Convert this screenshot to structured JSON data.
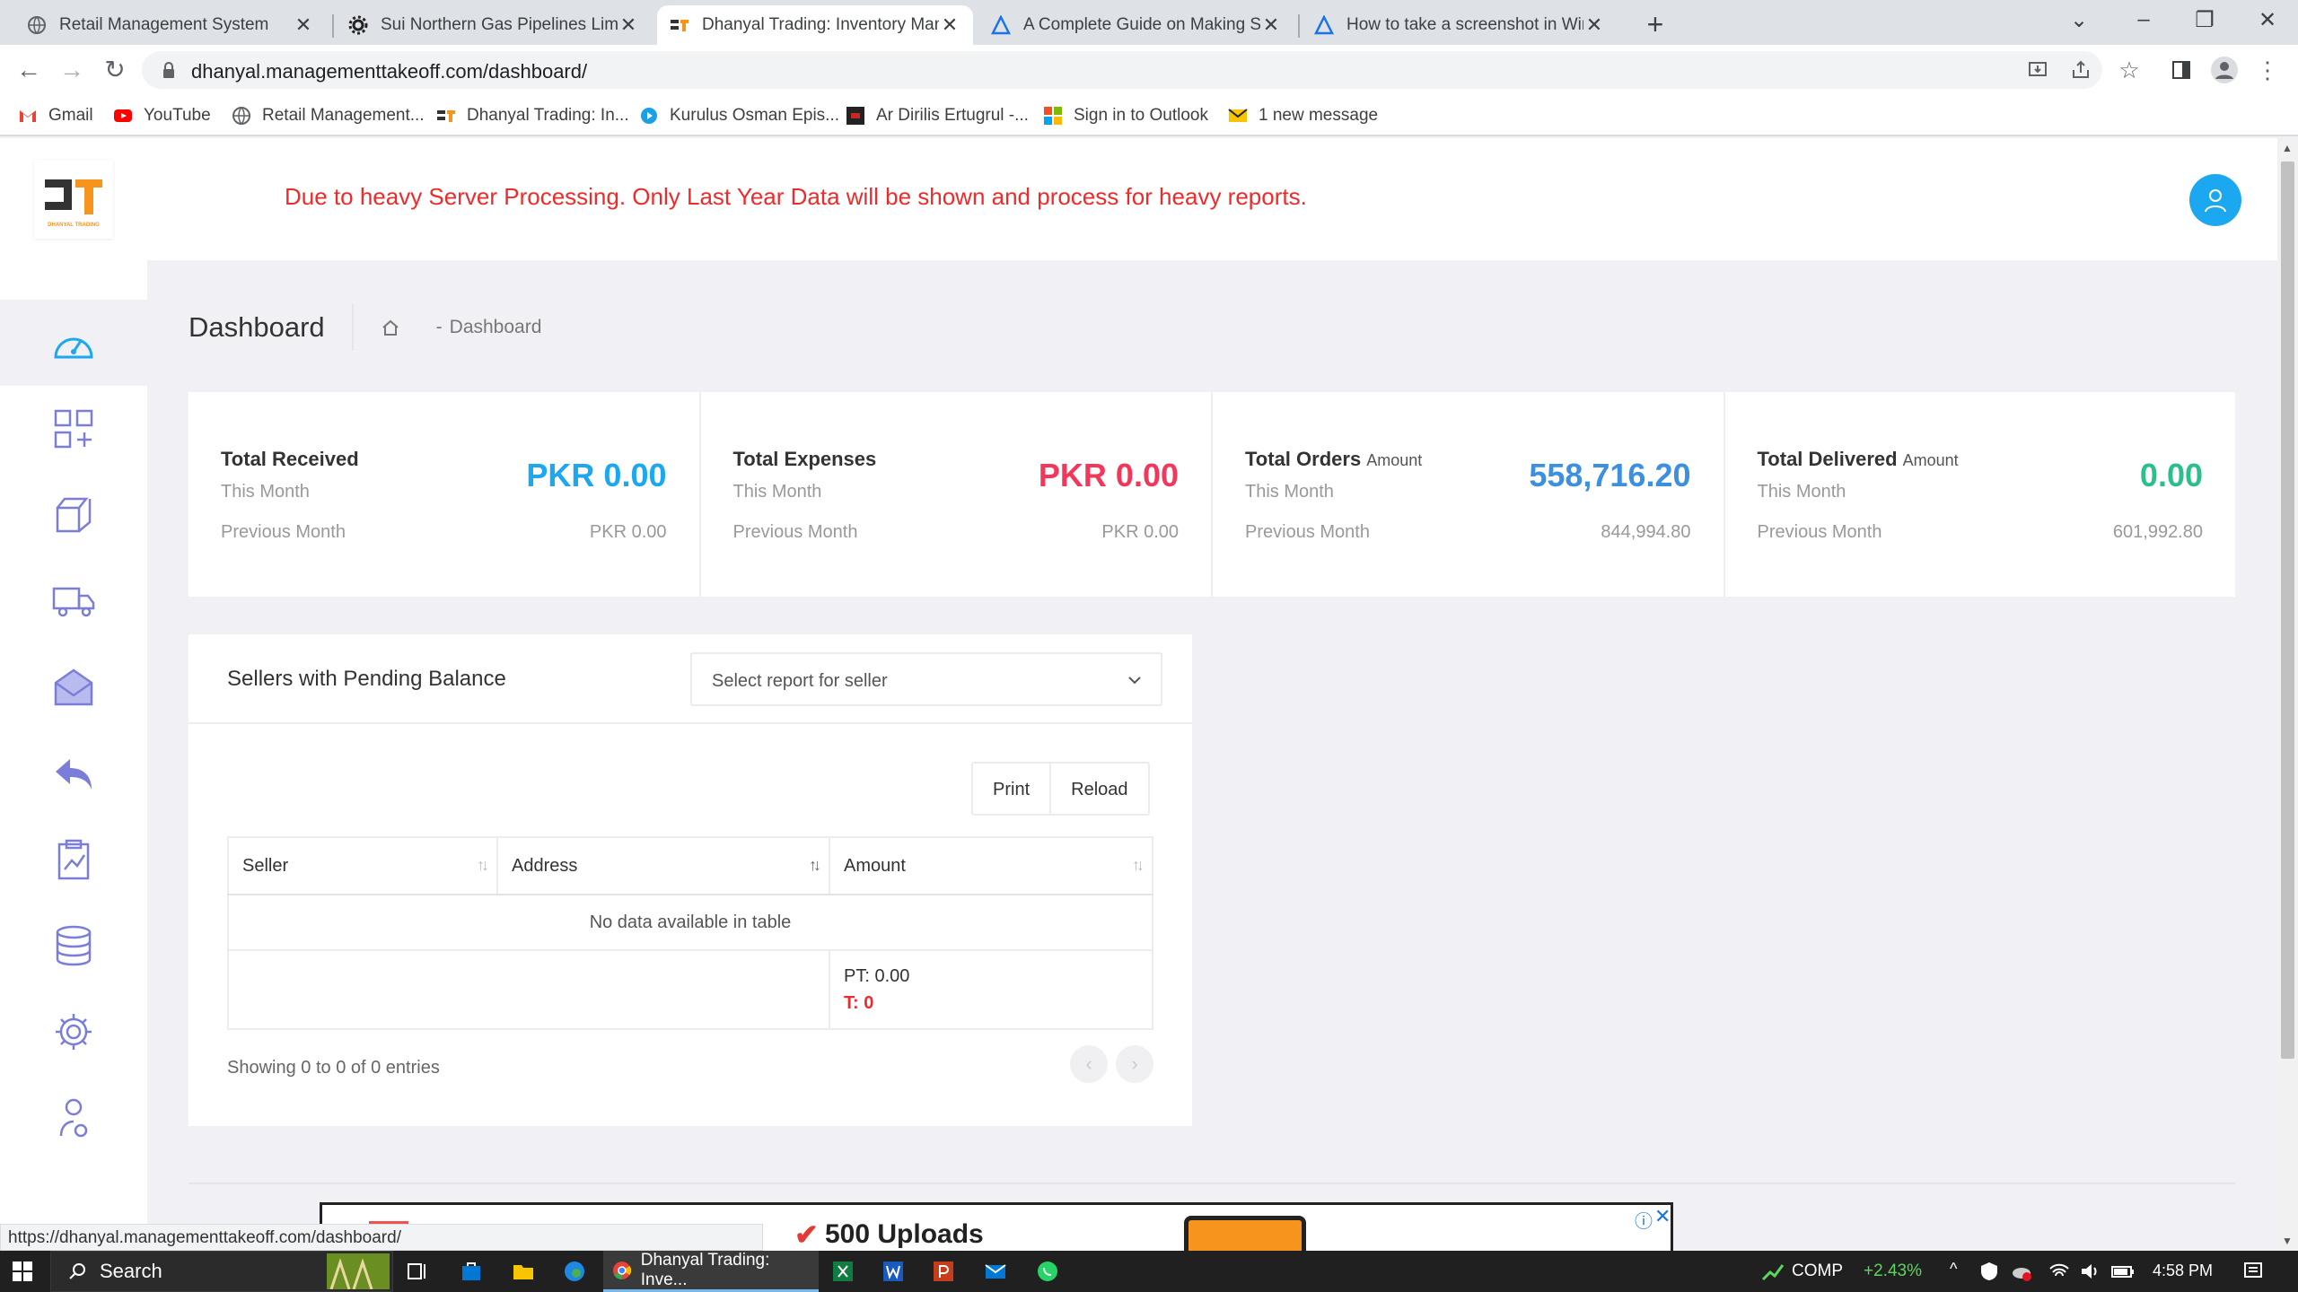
{
  "browser": {
    "tabs": [
      {
        "title": "Retail Management System"
      },
      {
        "title": "Sui Northern Gas Pipelines Limite"
      },
      {
        "title": "Dhanyal Trading: Inventory Mana"
      },
      {
        "title": "A Complete Guide on Making Sc"
      },
      {
        "title": "How to take a screenshot in Wind"
      }
    ],
    "url": "dhanyal.managementtakeoff.com/dashboard/",
    "bookmarks": [
      {
        "label": "Gmail"
      },
      {
        "label": "YouTube"
      },
      {
        "label": "Retail Management..."
      },
      {
        "label": "Dhanyal Trading: In..."
      },
      {
        "label": "Kurulus Osman Epis..."
      },
      {
        "label": "Ar Dirilis Ertugrul -..."
      },
      {
        "label": "Sign in to Outlook"
      },
      {
        "label": "1 new message"
      }
    ],
    "status_url": "https://dhanyal.managementtakeoff.com/dashboard/"
  },
  "app": {
    "logo_text": "DHANYAL TRADING",
    "notice": "Due to heavy Server Processing. Only Last Year Data will be shown and process for heavy reports.",
    "page_title": "Dashboard",
    "breadcrumb": "Dashboard",
    "sidebar_icons": [
      "dashboard-gauge-icon",
      "add-grid-icon",
      "packages-icon",
      "delivery-truck-icon",
      "mail-icon",
      "return-icon",
      "report-clipboard-icon",
      "coins-icon",
      "settings-gear-icon",
      "user-settings-icon"
    ]
  },
  "stats": [
    {
      "title": "Total Received",
      "suffix": "",
      "sub": "This Month",
      "value": "PKR 0.00",
      "prev_label": "Previous Month",
      "prev_value": "PKR 0.00",
      "color": "#1ba8f0"
    },
    {
      "title": "Total Expenses",
      "suffix": "",
      "sub": "This Month",
      "value": "PKR 0.00",
      "prev_label": "Previous Month",
      "prev_value": "PKR 0.00",
      "color": "#f1375a"
    },
    {
      "title": "Total Orders",
      "suffix": "Amount",
      "sub": "This Month",
      "value": "558,716.20",
      "prev_label": "Previous Month",
      "prev_value": "844,994.80",
      "color": "#3d8fe0"
    },
    {
      "title": "Total Delivered",
      "suffix": "Amount",
      "sub": "This Month",
      "value": "0.00",
      "prev_label": "Previous Month",
      "prev_value": "601,992.80",
      "color": "#2bbf8c"
    }
  ],
  "sellers": {
    "title": "Sellers with Pending Balance",
    "select_placeholder": "Select report for seller",
    "print_label": "Print",
    "reload_label": "Reload",
    "columns": [
      "Seller",
      "Address",
      "Amount"
    ],
    "empty_text": "No data available in table",
    "pt_total": "PT: 0.00",
    "t_total": "T: 0",
    "entries_text": "Showing 0 to 0 of 0 entries"
  },
  "ad": {
    "text": "500 Uploads"
  },
  "taskbar": {
    "search_label": "Search",
    "chrome_label": "Dhanyal Trading: Inve...",
    "stock_name": "COMP",
    "stock_change": "+2.43%",
    "time": "4:58 PM"
  },
  "colors": {
    "accent": "#1ba8f0",
    "notice": "#ee2b2b",
    "sidebar_icon": "#7b7ed9"
  }
}
